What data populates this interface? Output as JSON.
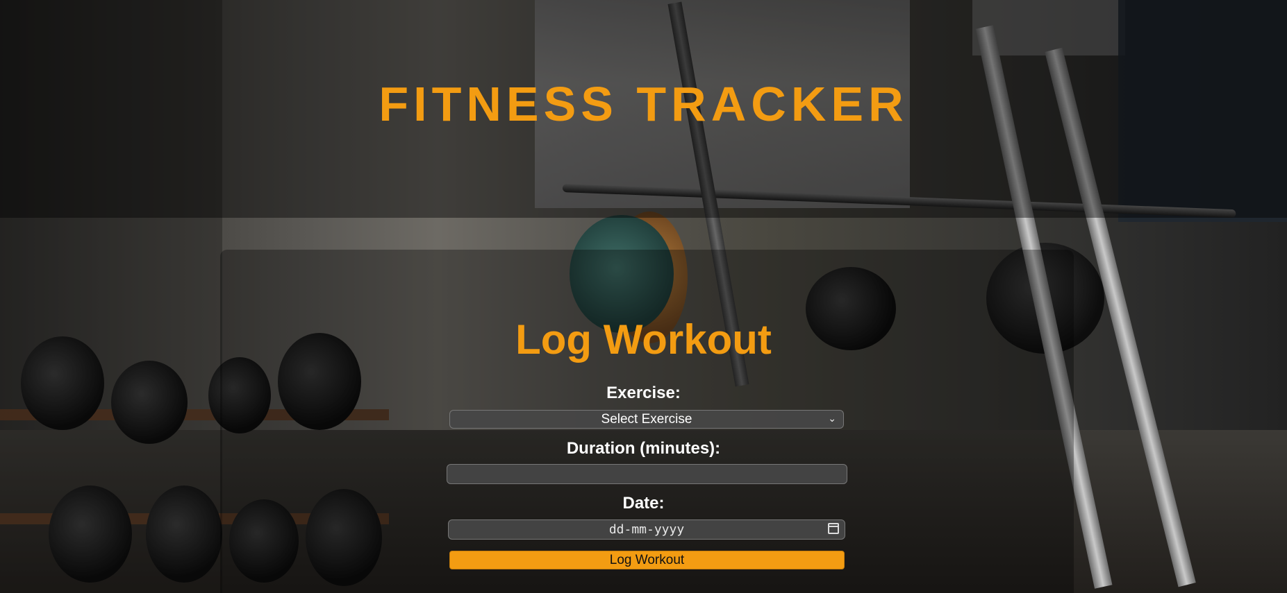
{
  "app": {
    "title": "FITNESS TRACKER",
    "accent_color": "#f39c12"
  },
  "form": {
    "title": "Log Workout",
    "exercise_label": "Exercise:",
    "exercise_selected": "Select Exercise",
    "exercise_icon": "chevron-down-icon",
    "duration_label": "Duration (minutes):",
    "duration_value": "",
    "date_label": "Date:",
    "date_placeholder": "dd-mm-yyyy",
    "date_icon": "calendar-icon",
    "submit_label": "Log Workout"
  }
}
